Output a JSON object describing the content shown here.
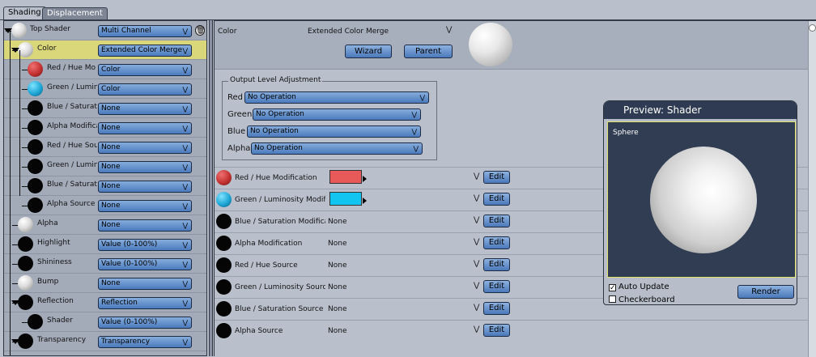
{
  "tabs": [
    {
      "label": "Shading",
      "active": true
    },
    {
      "label": "Displacement",
      "active": false
    }
  ],
  "tree": [
    {
      "label": "Top Shader",
      "ball": "white",
      "value": "Multi Channel",
      "selected": false,
      "level": 0
    },
    {
      "label": "Color",
      "ball": "white",
      "value": "Extended Color Merge",
      "selected": true,
      "level": 1
    },
    {
      "label": "Red / Hue  Mo",
      "ball": "red",
      "value": "Color",
      "selected": false,
      "level": 2
    },
    {
      "label": "Green / Lumin",
      "ball": "cyan",
      "value": "Color",
      "selected": false,
      "level": 2
    },
    {
      "label": "Blue / Saturati",
      "ball": "black",
      "value": "None",
      "selected": false,
      "level": 2
    },
    {
      "label": "Alpha Modifica",
      "ball": "black",
      "value": "None",
      "selected": false,
      "level": 2
    },
    {
      "label": "Red / Hue Sou",
      "ball": "black",
      "value": "None",
      "selected": false,
      "level": 2
    },
    {
      "label": "Green / Lumin",
      "ball": "black",
      "value": "None",
      "selected": false,
      "level": 2
    },
    {
      "label": "Blue / Saturati",
      "ball": "black",
      "value": "None",
      "selected": false,
      "level": 2
    },
    {
      "label": "Alpha Source",
      "ball": "black",
      "value": "None",
      "selected": false,
      "level": 2
    },
    {
      "label": "Alpha",
      "ball": "white",
      "value": "None",
      "selected": false,
      "level": 1
    },
    {
      "label": "Highlight",
      "ball": "black",
      "value": "Value (0-100%)",
      "selected": false,
      "level": 1
    },
    {
      "label": "Shininess",
      "ball": "black",
      "value": "Value (0-100%)",
      "selected": false,
      "level": 1
    },
    {
      "label": "Bump",
      "ball": "white",
      "value": "None",
      "selected": false,
      "level": 1
    },
    {
      "label": "Reflection",
      "ball": "black",
      "value": "Reflection",
      "selected": false,
      "level": 1
    },
    {
      "label": "Shader",
      "ball": "black",
      "value": "Value (0-100%)",
      "selected": false,
      "level": 2
    },
    {
      "label": "Transparency",
      "ball": "black",
      "value": "Transparency",
      "selected": false,
      "level": 1
    }
  ],
  "header": {
    "title": "Color",
    "type_label": "Extended Color Merge",
    "wizard_label": "Wizard",
    "parent_label": "Parent"
  },
  "output_level": {
    "title": "Output Level Adjustment",
    "rows": [
      {
        "label": "Red",
        "value": "No Operation"
      },
      {
        "label": "Green",
        "value": "No Operation"
      },
      {
        "label": "Blue",
        "value": "No Operation"
      },
      {
        "label": "Alpha",
        "value": "No Operation"
      }
    ]
  },
  "operations": [
    {
      "name": "Red / Hue  Modification",
      "ball": "red",
      "value": "",
      "swatch": "#e85a5a",
      "edit": "Edit"
    },
    {
      "name": "Green / Luminosity Modif",
      "ball": "cyan",
      "value": "",
      "swatch": "#12c4f0",
      "edit": "Edit"
    },
    {
      "name": "Blue / Saturation Modifica",
      "ball": "black",
      "value": "None",
      "swatch": "",
      "edit": "Edit"
    },
    {
      "name": "Alpha Modification",
      "ball": "black",
      "value": "None",
      "swatch": "",
      "edit": "Edit"
    },
    {
      "name": "Red / Hue Source",
      "ball": "black",
      "value": "None",
      "swatch": "",
      "edit": "Edit"
    },
    {
      "name": "Green / Luminosity Source",
      "ball": "black",
      "value": "None",
      "swatch": "",
      "edit": "Edit"
    },
    {
      "name": "Blue / Saturation Source",
      "ball": "black",
      "value": "None",
      "swatch": "",
      "edit": "Edit"
    },
    {
      "name": "Alpha Source",
      "ball": "black",
      "value": "None",
      "swatch": "",
      "edit": "Edit"
    }
  ],
  "preview": {
    "title": "Preview: Shader",
    "object": "Sphere",
    "auto_update_label": "Auto Update",
    "auto_update_checked": true,
    "checkerboard_label": "Checkerboard",
    "checkerboard_checked": false,
    "render_label": "Render"
  },
  "icons": {
    "dropdown": "chevron-down-icon",
    "double_chevron": "double-chevron-down-icon",
    "trash": "trash-icon",
    "expand": "expand-triangle-icon"
  }
}
